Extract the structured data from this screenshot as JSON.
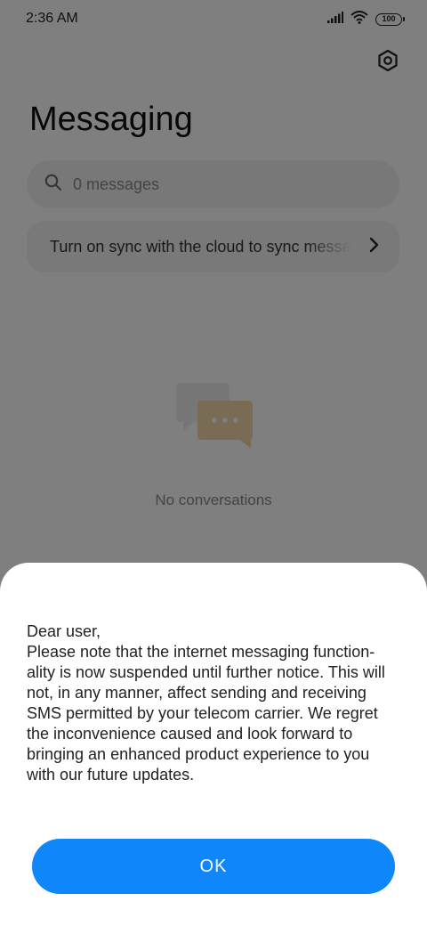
{
  "status_bar": {
    "time": "2:36 AM",
    "battery_level": "100",
    "icons": [
      "signal-icon",
      "wifi-icon",
      "battery-icon"
    ]
  },
  "header": {
    "title": "Messaging",
    "settings_icon": "settings-hexagon-icon"
  },
  "search": {
    "placeholder": "0 messages",
    "icon": "search-icon"
  },
  "sync_banner": {
    "text": "Turn on sync with the cloud to sync messages",
    "icon": "chevron-right-icon"
  },
  "empty_state": {
    "icon": "chat-bubbles-icon",
    "text": "No conversations"
  },
  "dialog": {
    "greeting": "Dear user,",
    "message": "Please note that the internet messaging function-\nality is now suspended until further notice. This will\nnot, in any manner, affect sending and receiving\nSMS permitted by your telecom carrier. We regret\nthe inconvenience caused and look forward to\nbringing an enhanced product experience to you\nwith our future updates.",
    "ok_label": "OK"
  },
  "colors": {
    "accent": "#0f87fb",
    "overlay": "rgba(0,0,0,0.5)",
    "illustration": "#f5d9a8"
  }
}
